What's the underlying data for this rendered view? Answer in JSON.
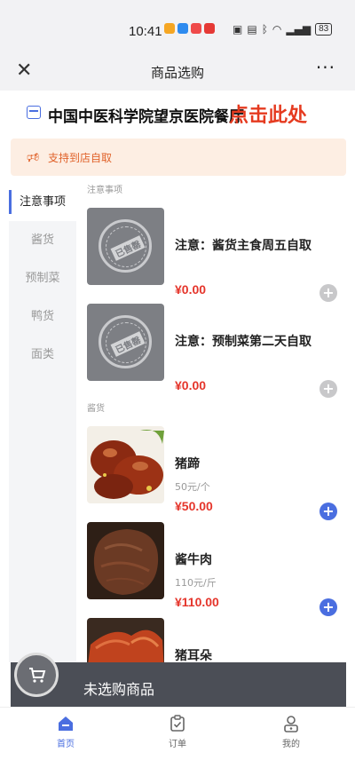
{
  "status": {
    "time": "10:41",
    "battery": "83"
  },
  "nav": {
    "title": "商品选购"
  },
  "store": {
    "name": "中国中医科学院望京医院餐厅",
    "tap_hint": "点击此处"
  },
  "notice": {
    "text": "支持到店自取"
  },
  "categories": [
    "注意事项",
    "酱货",
    "预制菜",
    "鸭货",
    "面类"
  ],
  "sections": [
    {
      "title": "注意事项",
      "products": [
        {
          "name": "注意：酱货主食周五自取",
          "price": "¥0.00",
          "sold_out": true,
          "sold_label": "已售罄"
        },
        {
          "name": "注意：预制菜第二天自取",
          "price": "¥0.00",
          "sold_out": true,
          "sold_label": "已售罄"
        }
      ]
    },
    {
      "title": "酱货",
      "products": [
        {
          "name": "猪蹄",
          "spec": "50元/个",
          "price": "¥50.00"
        },
        {
          "name": "酱牛肉",
          "spec": "110元/斤",
          "price": "¥110.00"
        },
        {
          "name": "猪耳朵"
        }
      ]
    }
  ],
  "cart": {
    "text": "未选购商品"
  },
  "tabs": [
    "首页",
    "订单",
    "我的"
  ],
  "colors": {
    "accent": "#4a6ee0",
    "price": "#e5352b",
    "store_tap": "#e53a1f",
    "notice": "#e0622a"
  }
}
